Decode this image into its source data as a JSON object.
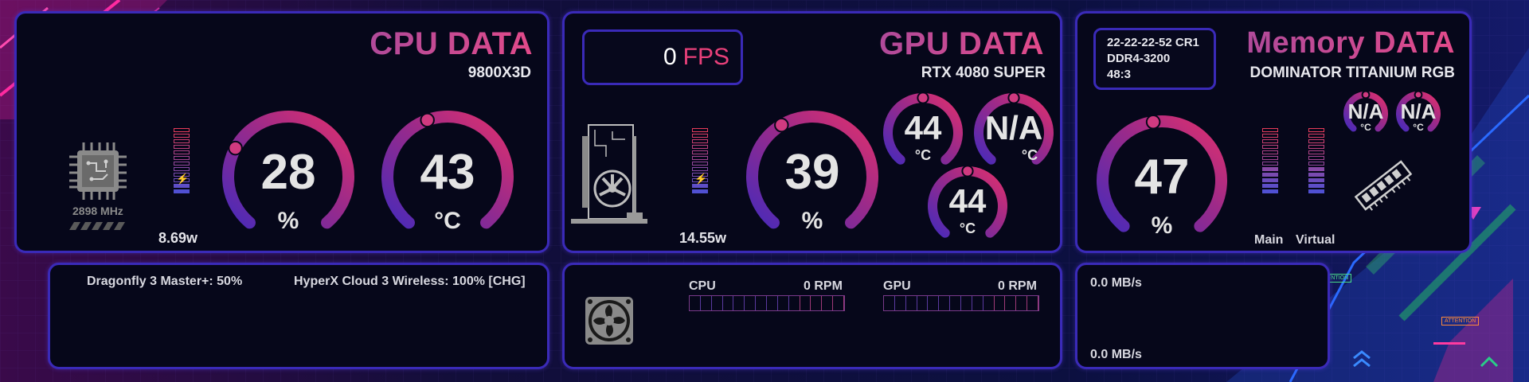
{
  "cpu": {
    "title": "CPU DATA",
    "model": "9800X3D",
    "clock": "2898 MHz",
    "power": "8.69w",
    "usage": 28,
    "usage_unit": "%",
    "temp": 43,
    "temp_unit": "°C",
    "power_fill": 0.18
  },
  "gpu": {
    "title": "GPU DATA",
    "model": "RTX 4080 SUPER",
    "fps_value": "0",
    "fps_label": "FPS",
    "power": "14.55w",
    "usage": 39,
    "usage_unit": "%",
    "temp1": "44",
    "temp2": "N/A",
    "temp3": "44",
    "temp_unit": "°C",
    "power_fill": 0.15
  },
  "memory": {
    "title": "Memory DATA",
    "model": "DOMINATOR TITANIUM RGB",
    "timings": "22-22-22-52 CR1",
    "speed": "DDR4-3200",
    "ratio": "48:3",
    "usage": 47,
    "usage_unit": "%",
    "temp1": "N/A",
    "temp2": "N/A",
    "temp_unit": "°C",
    "main_label": "Main",
    "virtual_label": "Virtual",
    "main_fill": 0.45,
    "virtual_fill": 0.4
  },
  "devices": {
    "mouse": "Dragonfly 3 Master+: 50%",
    "headset": "HyperX Cloud 3 Wireless: 100% [CHG]"
  },
  "fans": {
    "cpu_label": "CPU",
    "cpu_rpm": "0 RPM",
    "gpu_label": "GPU",
    "gpu_rpm": "0 RPM"
  },
  "network": {
    "rate1": "0.0 MB/s",
    "rate2": "0.0 MB/s"
  },
  "deco": {
    "attention": "ATTENTION"
  },
  "colors": {
    "accent_pink": "#e0306e",
    "accent_purple": "#5a2fd0",
    "panel_border": "#3a2ab8",
    "background": "#0a0c2e"
  }
}
